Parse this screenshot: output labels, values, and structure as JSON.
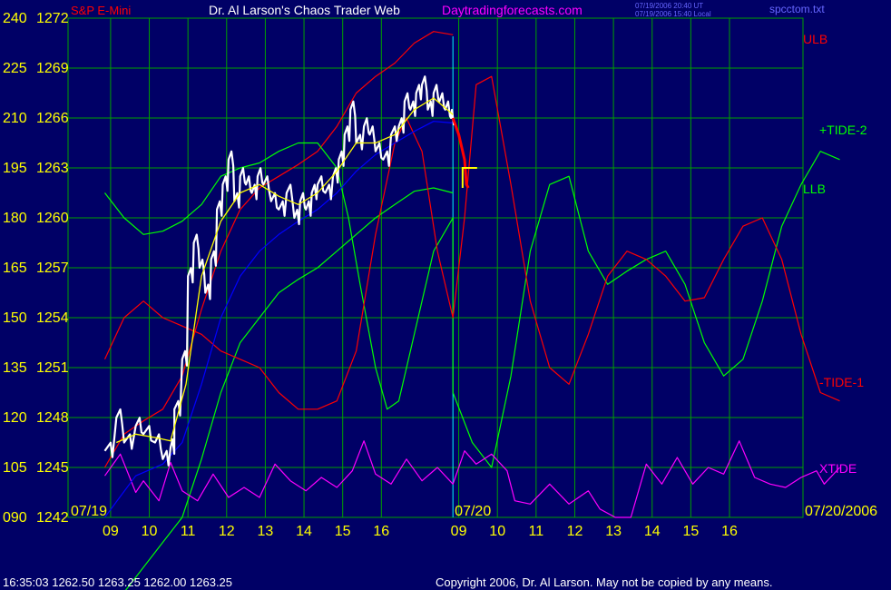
{
  "header": {
    "symbol": "S&P E-Mini",
    "title": "Dr. Al Larson's Chaos Trader Web",
    "site": "Daytradingforecasts.com",
    "timestamp_ut": "07/19/2006 20:40 UT",
    "timestamp_local": "07/19/2006 15:40 Local",
    "filename": "spcctom.txt"
  },
  "footer": {
    "last_bar": "16:35:03   1262.50  1263.25  1262.00  1263.25",
    "copyright": "Copyright 2006, Dr. Al Larson. May not be copied by any means."
  },
  "chart_data": {
    "type": "line",
    "colors": {
      "background": "#000066",
      "grid": "#00a000",
      "price": "#ffffff",
      "ma_fast": "#ffff00",
      "ma_slow": "#0000ff",
      "ulb": "#ff0000",
      "tide_plus": "#00ff00",
      "tide_minus": "#ff0000",
      "xtide": "#ff00ff",
      "forecast": "#ff0000",
      "envelope": "#ff0000",
      "envelope_low": "#00ff00"
    },
    "y_left_ticks": [
      "240",
      "225",
      "210",
      "195",
      "180",
      "165",
      "150",
      "135",
      "120",
      "105",
      "090"
    ],
    "y_price_ticks": [
      "1272",
      "1269",
      "1266",
      "1263",
      "1260",
      "1257",
      "1254",
      "1251",
      "1248",
      "1245",
      "1242"
    ],
    "ylim_price": [
      1242,
      1272
    ],
    "ylim_left": [
      90,
      240
    ],
    "x_ticks": [
      "09",
      "10",
      "11",
      "12",
      "13",
      "14",
      "15",
      "16",
      "09",
      "10",
      "11",
      "12",
      "13",
      "14",
      "15",
      "16"
    ],
    "date_labels": [
      "07/19",
      "07/20",
      "07/20/2006"
    ],
    "series_labels": [
      "ULB",
      "+TIDE-2",
      "LLB",
      "-TIDE-1",
      "XTIDE"
    ],
    "price_path": [
      [
        0.0,
        1246.0
      ],
      [
        0.3,
        1248.0
      ],
      [
        0.5,
        1246.5
      ],
      [
        0.8,
        1247.5
      ],
      [
        1.0,
        1247.0
      ],
      [
        1.3,
        1246.5
      ],
      [
        1.5,
        1245.5
      ],
      [
        1.7,
        1246.2
      ],
      [
        1.8,
        1248.5
      ],
      [
        2.0,
        1251.5
      ],
      [
        2.15,
        1256.5
      ],
      [
        2.3,
        1258.5
      ],
      [
        2.45,
        1257.0
      ],
      [
        2.6,
        1255.5
      ],
      [
        2.75,
        1257.5
      ],
      [
        2.9,
        1260.5
      ],
      [
        3.05,
        1262.0
      ],
      [
        3.2,
        1263.5
      ],
      [
        3.35,
        1261.0
      ],
      [
        3.5,
        1262.5
      ],
      [
        3.65,
        1262.0
      ],
      [
        3.8,
        1261.5
      ],
      [
        3.95,
        1262.5
      ],
      [
        4.1,
        1262.0
      ],
      [
        4.3,
        1261.0
      ],
      [
        4.5,
        1260.5
      ],
      [
        4.7,
        1261.5
      ],
      [
        4.9,
        1260.0
      ],
      [
        5.05,
        1261.0
      ],
      [
        5.2,
        1260.5
      ],
      [
        5.35,
        1261.5
      ],
      [
        5.5,
        1262.0
      ],
      [
        5.7,
        1261.5
      ],
      [
        5.9,
        1262.5
      ],
      [
        6.05,
        1263.5
      ],
      [
        6.2,
        1265.0
      ],
      [
        6.35,
        1266.5
      ],
      [
        6.5,
        1264.5
      ],
      [
        6.7,
        1265.5
      ],
      [
        6.85,
        1265.0
      ],
      [
        7.0,
        1264.0
      ],
      [
        7.2,
        1263.5
      ],
      [
        7.4,
        1265.0
      ],
      [
        7.6,
        1265.5
      ],
      [
        7.75,
        1267.0
      ],
      [
        7.9,
        1266.5
      ],
      [
        8.05,
        1267.5
      ],
      [
        8.2,
        1268.0
      ],
      [
        8.35,
        1266.5
      ],
      [
        8.5,
        1267.5
      ],
      [
        8.65,
        1267.0
      ],
      [
        8.8,
        1266.5
      ],
      [
        8.95,
        1266.0
      ],
      [
        9.0,
        1266.0
      ]
    ],
    "ma_fast": [
      [
        0.3,
        1246.5
      ],
      [
        0.8,
        1247.0
      ],
      [
        1.3,
        1246.8
      ],
      [
        1.7,
        1246.6
      ],
      [
        2.1,
        1250.0
      ],
      [
        2.5,
        1256.5
      ],
      [
        3.0,
        1259.8
      ],
      [
        3.5,
        1261.5
      ],
      [
        4.0,
        1262.0
      ],
      [
        4.5,
        1261.3
      ],
      [
        5.0,
        1260.8
      ],
      [
        5.5,
        1261.5
      ],
      [
        6.0,
        1262.8
      ],
      [
        6.5,
        1264.5
      ],
      [
        7.0,
        1264.5
      ],
      [
        7.5,
        1265.0
      ],
      [
        8.0,
        1266.5
      ],
      [
        8.5,
        1267.2
      ],
      [
        9.0,
        1266.2
      ]
    ],
    "ma_slow": [
      [
        0.0,
        1242.0
      ],
      [
        0.8,
        1244.5
      ],
      [
        1.5,
        1245.2
      ],
      [
        2.0,
        1246.5
      ],
      [
        2.5,
        1250.0
      ],
      [
        3.0,
        1254.0
      ],
      [
        3.5,
        1256.5
      ],
      [
        4.0,
        1258.0
      ],
      [
        4.5,
        1259.0
      ],
      [
        5.0,
        1259.8
      ],
      [
        5.5,
        1260.5
      ],
      [
        6.0,
        1261.5
      ],
      [
        6.5,
        1262.8
      ],
      [
        7.0,
        1263.8
      ],
      [
        7.5,
        1264.5
      ],
      [
        8.0,
        1265.2
      ],
      [
        8.5,
        1265.8
      ],
      [
        9.0,
        1265.7
      ]
    ],
    "ulb": [
      [
        0.0,
        1245.0
      ],
      [
        0.5,
        1247.0
      ],
      [
        1.0,
        1247.8
      ],
      [
        1.5,
        1248.5
      ],
      [
        2.0,
        1250.5
      ],
      [
        2.5,
        1254.5
      ],
      [
        3.0,
        1258.0
      ],
      [
        3.5,
        1260.5
      ],
      [
        4.0,
        1261.8
      ],
      [
        4.5,
        1262.5
      ],
      [
        5.0,
        1263.2
      ],
      [
        5.5,
        1264.0
      ],
      [
        6.0,
        1265.5
      ],
      [
        6.5,
        1267.5
      ],
      [
        7.0,
        1268.5
      ],
      [
        7.5,
        1269.3
      ],
      [
        8.0,
        1270.5
      ],
      [
        8.5,
        1271.2
      ],
      [
        9.0,
        1271.0
      ]
    ],
    "llb": [
      [
        0.0,
        1236.0
      ],
      [
        0.5,
        1237.5
      ],
      [
        1.0,
        1239.0
      ],
      [
        1.5,
        1240.5
      ],
      [
        2.0,
        1242.0
      ],
      [
        2.5,
        1245.5
      ],
      [
        3.0,
        1249.5
      ],
      [
        3.5,
        1252.5
      ],
      [
        4.0,
        1254.0
      ],
      [
        4.5,
        1255.5
      ],
      [
        5.0,
        1256.3
      ],
      [
        5.5,
        1257.0
      ],
      [
        6.0,
        1258.0
      ],
      [
        6.5,
        1259.0
      ],
      [
        7.0,
        1260.0
      ],
      [
        7.5,
        1260.8
      ],
      [
        8.0,
        1261.6
      ],
      [
        8.5,
        1261.8
      ],
      [
        9.0,
        1261.5
      ]
    ],
    "tide_plus": [
      [
        0.0,
        1261.5
      ],
      [
        0.5,
        1260.0
      ],
      [
        1.0,
        1259.0
      ],
      [
        1.5,
        1259.2
      ],
      [
        2.0,
        1259.8
      ],
      [
        2.5,
        1260.8
      ],
      [
        3.0,
        1262.5
      ],
      [
        3.5,
        1263.0
      ],
      [
        4.0,
        1263.3
      ],
      [
        4.5,
        1264.0
      ],
      [
        5.0,
        1264.5
      ],
      [
        5.5,
        1264.5
      ],
      [
        6.0,
        1263.0
      ],
      [
        6.3,
        1260.0
      ],
      [
        6.6,
        1256.0
      ],
      [
        7.0,
        1251.0
      ],
      [
        7.3,
        1248.5
      ],
      [
        7.6,
        1249.0
      ],
      [
        8.0,
        1253.0
      ],
      [
        8.5,
        1258.0
      ],
      [
        9.0,
        1260.0
      ],
      [
        9.0,
        1249.5
      ],
      [
        9.5,
        1246.5
      ],
      [
        10.0,
        1245.0
      ],
      [
        10.5,
        1250.5
      ],
      [
        11.0,
        1258.0
      ],
      [
        11.5,
        1262.0
      ],
      [
        12.0,
        1262.5
      ],
      [
        12.5,
        1258.0
      ],
      [
        13.0,
        1256.0
      ],
      [
        13.5,
        1256.8
      ],
      [
        14.0,
        1257.5
      ],
      [
        14.5,
        1258.0
      ],
      [
        15.0,
        1256.0
      ],
      [
        15.5,
        1252.5
      ],
      [
        16.0,
        1250.5
      ],
      [
        16.5,
        1251.5
      ],
      [
        17.0,
        1255.0
      ],
      [
        17.5,
        1259.5
      ],
      [
        18.0,
        1262.0
      ],
      [
        18.5,
        1264.0
      ],
      [
        19.0,
        1263.5
      ]
    ],
    "tide_minus": [
      [
        0.0,
        1251.5
      ],
      [
        0.5,
        1254.0
      ],
      [
        1.0,
        1255.0
      ],
      [
        1.5,
        1254.0
      ],
      [
        2.0,
        1253.5
      ],
      [
        2.5,
        1253.0
      ],
      [
        3.0,
        1252.0
      ],
      [
        3.5,
        1251.5
      ],
      [
        4.0,
        1251.0
      ],
      [
        4.5,
        1249.5
      ],
      [
        5.0,
        1248.5
      ],
      [
        5.5,
        1248.5
      ],
      [
        6.0,
        1249.0
      ],
      [
        6.5,
        1252.0
      ],
      [
        7.0,
        1259.0
      ],
      [
        7.5,
        1264.5
      ],
      [
        7.8,
        1266.0
      ],
      [
        8.2,
        1264.0
      ],
      [
        8.6,
        1258.0
      ],
      [
        9.0,
        1254.0
      ],
      [
        9.3,
        1260.0
      ],
      [
        9.6,
        1268.0
      ],
      [
        10.0,
        1268.5
      ],
      [
        10.5,
        1262.0
      ],
      [
        11.0,
        1255.0
      ],
      [
        11.5,
        1251.0
      ],
      [
        12.0,
        1250.0
      ],
      [
        12.5,
        1253.0
      ],
      [
        13.0,
        1256.5
      ],
      [
        13.5,
        1258.0
      ],
      [
        14.0,
        1257.5
      ],
      [
        14.5,
        1256.5
      ],
      [
        15.0,
        1255.0
      ],
      [
        15.5,
        1255.2
      ],
      [
        16.0,
        1257.5
      ],
      [
        16.5,
        1259.5
      ],
      [
        17.0,
        1260.0
      ],
      [
        17.5,
        1257.5
      ],
      [
        18.0,
        1253.0
      ],
      [
        18.5,
        1249.5
      ],
      [
        19.0,
        1249.0
      ]
    ],
    "xtide": [
      [
        0.0,
        1244.5
      ],
      [
        0.4,
        1245.8
      ],
      [
        0.8,
        1243.5
      ],
      [
        1.0,
        1244.2
      ],
      [
        1.4,
        1243.0
      ],
      [
        1.7,
        1245.3
      ],
      [
        2.0,
        1243.6
      ],
      [
        2.4,
        1243.0
      ],
      [
        2.8,
        1244.6
      ],
      [
        3.2,
        1243.2
      ],
      [
        3.6,
        1243.8
      ],
      [
        4.0,
        1243.2
      ],
      [
        4.4,
        1245.2
      ],
      [
        4.8,
        1244.2
      ],
      [
        5.2,
        1243.6
      ],
      [
        5.6,
        1244.4
      ],
      [
        6.0,
        1243.8
      ],
      [
        6.4,
        1244.8
      ],
      [
        6.7,
        1246.6
      ],
      [
        7.0,
        1244.6
      ],
      [
        7.4,
        1244.0
      ],
      [
        7.8,
        1245.5
      ],
      [
        8.2,
        1244.2
      ],
      [
        8.6,
        1245.0
      ],
      [
        9.0,
        1244.0
      ],
      [
        9.3,
        1246.0
      ],
      [
        9.6,
        1245.2
      ],
      [
        10.0,
        1245.8
      ],
      [
        10.4,
        1244.8
      ],
      [
        10.6,
        1243.0
      ],
      [
        11.0,
        1242.8
      ],
      [
        11.5,
        1244.0
      ],
      [
        12.0,
        1242.8
      ],
      [
        12.5,
        1243.6
      ],
      [
        12.8,
        1242.5
      ],
      [
        13.2,
        1242.0
      ],
      [
        13.6,
        1242.0
      ],
      [
        14.0,
        1245.2
      ],
      [
        14.4,
        1244.0
      ],
      [
        14.8,
        1245.6
      ],
      [
        15.2,
        1244.0
      ],
      [
        15.6,
        1245.0
      ],
      [
        16.0,
        1244.6
      ],
      [
        16.4,
        1246.6
      ],
      [
        16.8,
        1244.4
      ],
      [
        17.2,
        1244.0
      ],
      [
        17.6,
        1243.8
      ],
      [
        18.0,
        1244.4
      ],
      [
        18.4,
        1244.8
      ],
      [
        18.6,
        1244.0
      ],
      [
        19.0,
        1245.0
      ]
    ],
    "forecast_pen": [
      [
        9.0,
        1266.0
      ],
      [
        9.15,
        1265.0
      ],
      [
        9.3,
        1263.5
      ],
      [
        9.35,
        1262.0
      ],
      [
        9.4,
        1261.8
      ]
    ],
    "forecast_marker": [
      9.25,
      1263.0
    ]
  }
}
